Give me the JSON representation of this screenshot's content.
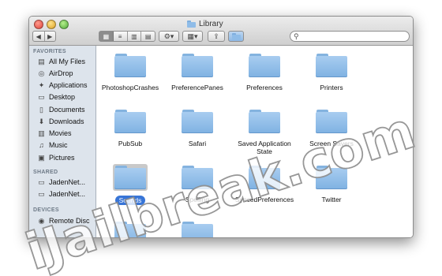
{
  "window": {
    "title": "Library"
  },
  "toolbar": {
    "back_glyph": "◀",
    "forward_glyph": "▶",
    "view_icons": [
      "icon-view-icon",
      "list-view-icon",
      "column-view-icon",
      "coverflow-view-icon"
    ],
    "action_glyph": "⚙▾",
    "arrange_glyph": "▦▾",
    "share_glyph": "⇪"
  },
  "search": {
    "placeholder": "",
    "value": ""
  },
  "sidebar": {
    "favorites_header": "FAVORITES",
    "favorites": [
      {
        "label": "All My Files",
        "icon": "all-files-icon",
        "glyph": "▤"
      },
      {
        "label": "AirDrop",
        "icon": "airdrop-icon",
        "glyph": "◎"
      },
      {
        "label": "Applications",
        "icon": "applications-icon",
        "glyph": "✦"
      },
      {
        "label": "Desktop",
        "icon": "desktop-icon",
        "glyph": "▭"
      },
      {
        "label": "Documents",
        "icon": "documents-icon",
        "glyph": "▯"
      },
      {
        "label": "Downloads",
        "icon": "downloads-icon",
        "glyph": "⬇"
      },
      {
        "label": "Movies",
        "icon": "movies-icon",
        "glyph": "▥"
      },
      {
        "label": "Music",
        "icon": "music-icon",
        "glyph": "♫"
      },
      {
        "label": "Pictures",
        "icon": "pictures-icon",
        "glyph": "▣"
      }
    ],
    "shared_header": "SHARED",
    "shared": [
      {
        "label": "JadenNet...",
        "icon": "computer-icon",
        "glyph": "▭"
      },
      {
        "label": "JadenNet...",
        "icon": "computer-icon",
        "glyph": "▭"
      }
    ],
    "devices_header": "DEVICES",
    "devices": [
      {
        "label": "Remote Disc",
        "icon": "disc-icon",
        "glyph": "◉"
      }
    ]
  },
  "files": [
    {
      "label": "PhotoshopCrashes"
    },
    {
      "label": "PreferencePanes"
    },
    {
      "label": "Preferences"
    },
    {
      "label": "Printers"
    },
    {
      "label": "PubSub"
    },
    {
      "label": "Safari"
    },
    {
      "label": "Saved Application State"
    },
    {
      "label": "Screen Savers"
    },
    {
      "label": "Sounds",
      "selected": true
    },
    {
      "label": "Spelling"
    },
    {
      "label": "SyncedPreferences"
    },
    {
      "label": "Twitter"
    },
    {
      "label": ""
    },
    {
      "label": ""
    }
  ],
  "watermark": {
    "text": "iJailbreak.com"
  },
  "colors": {
    "selection": "#3875d7",
    "sidebar_bg": "#dde4ec",
    "folder": "#8fbce8"
  }
}
